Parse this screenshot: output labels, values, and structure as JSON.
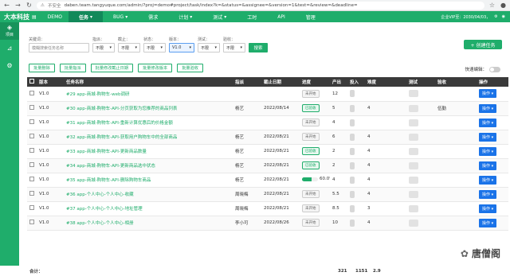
{
  "browser": {
    "insecure_label": "不安全",
    "url": "daben.team.tangyuque.com/admin/?proj=demo#project/task/index?k=&status=&assignee=&version=1&test=&review=&deadline="
  },
  "topnav": {
    "brand": "大本科技",
    "project": "DEMO",
    "menu": [
      {
        "label": "任务",
        "dropdown": true
      },
      {
        "label": "BUG",
        "dropdown": true
      },
      {
        "label": "需求",
        "dropdown": false
      },
      {
        "label": "计划",
        "dropdown": true
      },
      {
        "label": "测试",
        "dropdown": true
      },
      {
        "label": "工时",
        "dropdown": false
      },
      {
        "label": "API",
        "dropdown": false
      },
      {
        "label": "管理",
        "dropdown": false
      }
    ],
    "user_info": "企业VIP至：2030/04/03，"
  },
  "sidebar": {
    "items": [
      {
        "label": "项目",
        "icon": "layers-icon"
      },
      {
        "label": "",
        "icon": "chart-icon"
      },
      {
        "label": "",
        "icon": "settings-icon"
      }
    ]
  },
  "filters": {
    "keyword": {
      "label": "关键词：",
      "placeholder": "模糊搜索任务名称"
    },
    "status": {
      "label": "指派：",
      "value": "不限"
    },
    "deadline": {
      "label": "截止：",
      "value": "不限"
    },
    "state": {
      "label": "状态：",
      "value": "不限"
    },
    "version": {
      "label": "版本：",
      "value": "V1.0"
    },
    "test": {
      "label": "测试：",
      "value": "不限"
    },
    "review": {
      "label": "验收：",
      "value": "不限"
    },
    "search_label": "搜索",
    "create_label": "+ 创建任务"
  },
  "batch": {
    "buttons": [
      "批量删除",
      "批量指派",
      "批量修改截止日期",
      "批量修改版本",
      "批量验收"
    ],
    "quick_edit_label": "快速编辑："
  },
  "table": {
    "headers": [
      "版本",
      "任务名称",
      "指派",
      "截止日期",
      "进度",
      "产出",
      "投入",
      "难度",
      "测试",
      "验收",
      "操作"
    ],
    "rows": [
      {
        "version": "V1.0",
        "name": "#29 app-商城-购物车-web调研",
        "assignee": "",
        "deadline": "",
        "status": "未开始",
        "status_done": false,
        "output": "12",
        "input": "",
        "difficulty": "",
        "test": "",
        "accept": "",
        "op": "操作"
      },
      {
        "version": "V1.0",
        "name": "#30 app-商城-购物车-API-分页获取为您推荐的商品列表",
        "assignee": "杨艺",
        "deadline": "2022/08/14",
        "status": "已验收",
        "status_done": true,
        "output": "5",
        "input": "",
        "difficulty": "4",
        "test": "",
        "accept": "伍勤",
        "op": "操作"
      },
      {
        "version": "V1.0",
        "name": "#31 app-商城-购物车-API-重新计算优惠后的价格金额",
        "assignee": "",
        "deadline": "",
        "status": "未开始",
        "status_done": false,
        "output": "4",
        "input": "",
        "difficulty": "",
        "test": "",
        "accept": "",
        "op": "操作"
      },
      {
        "version": "V1.0",
        "name": "#32 app-商城-购物车-API-获取用户购物车中的全部商品",
        "assignee": "杨艺",
        "deadline": "2022/08/21",
        "status": "未开始",
        "status_done": false,
        "output": "6",
        "input": "",
        "difficulty": "4",
        "test": "",
        "accept": "",
        "op": "操作"
      },
      {
        "version": "V1.0",
        "name": "#33 app-商城-购物车-API-更新商品数量",
        "assignee": "杨艺",
        "deadline": "2022/08/21",
        "status": "已验收",
        "status_done": true,
        "output": "2",
        "input": "",
        "difficulty": "4",
        "test": "",
        "accept": "",
        "op": "操作"
      },
      {
        "version": "V1.0",
        "name": "#34 app-商城-购物车-API-更新商品选中状态",
        "assignee": "杨艺",
        "deadline": "2022/08/21",
        "status": "已验收",
        "status_done": true,
        "output": "2",
        "input": "",
        "difficulty": "4",
        "test": "",
        "accept": "",
        "op": "操作"
      },
      {
        "version": "V1.0",
        "name": "#35 app-商城-购物车-API-删除购物车商品",
        "assignee": "杨艺",
        "deadline": "2022/08/21",
        "status": "60.0%",
        "status_done": false,
        "progress": 0.6,
        "output": "4",
        "input": "",
        "difficulty": "4",
        "test": "",
        "accept": "",
        "op": "操作"
      },
      {
        "version": "V1.0",
        "name": "#36 app-个人中心-个人中心-收藏",
        "assignee": "周晓梅",
        "deadline": "2022/08/21",
        "status": "未开始",
        "status_done": false,
        "output": "5.5",
        "input": "",
        "difficulty": "4",
        "test": "",
        "accept": "",
        "op": "操作"
      },
      {
        "version": "V1.0",
        "name": "#37 app-个人中心-个人中心-地址管理",
        "assignee": "周晓梅",
        "deadline": "2022/08/21",
        "status": "未开始",
        "status_done": false,
        "output": "8.5",
        "input": "",
        "difficulty": "3",
        "test": "",
        "accept": "",
        "op": "操作"
      },
      {
        "version": "V1.0",
        "name": "#38 app-个人中心-个人中心-相册",
        "assignee": "李小可",
        "deadline": "2022/08/26",
        "status": "未开始",
        "status_done": false,
        "output": "10",
        "input": "",
        "difficulty": "4",
        "test": "",
        "accept": "",
        "op": "操作"
      }
    ],
    "totals": {
      "label": "合计：",
      "output": "321",
      "input": "1151",
      "difficulty": "2.9"
    }
  },
  "watermark": {
    "text": "唐僧阁"
  },
  "colors": {
    "brand": "#1fad6b",
    "header": "#3a3a3a",
    "action": "#1a73e8"
  }
}
